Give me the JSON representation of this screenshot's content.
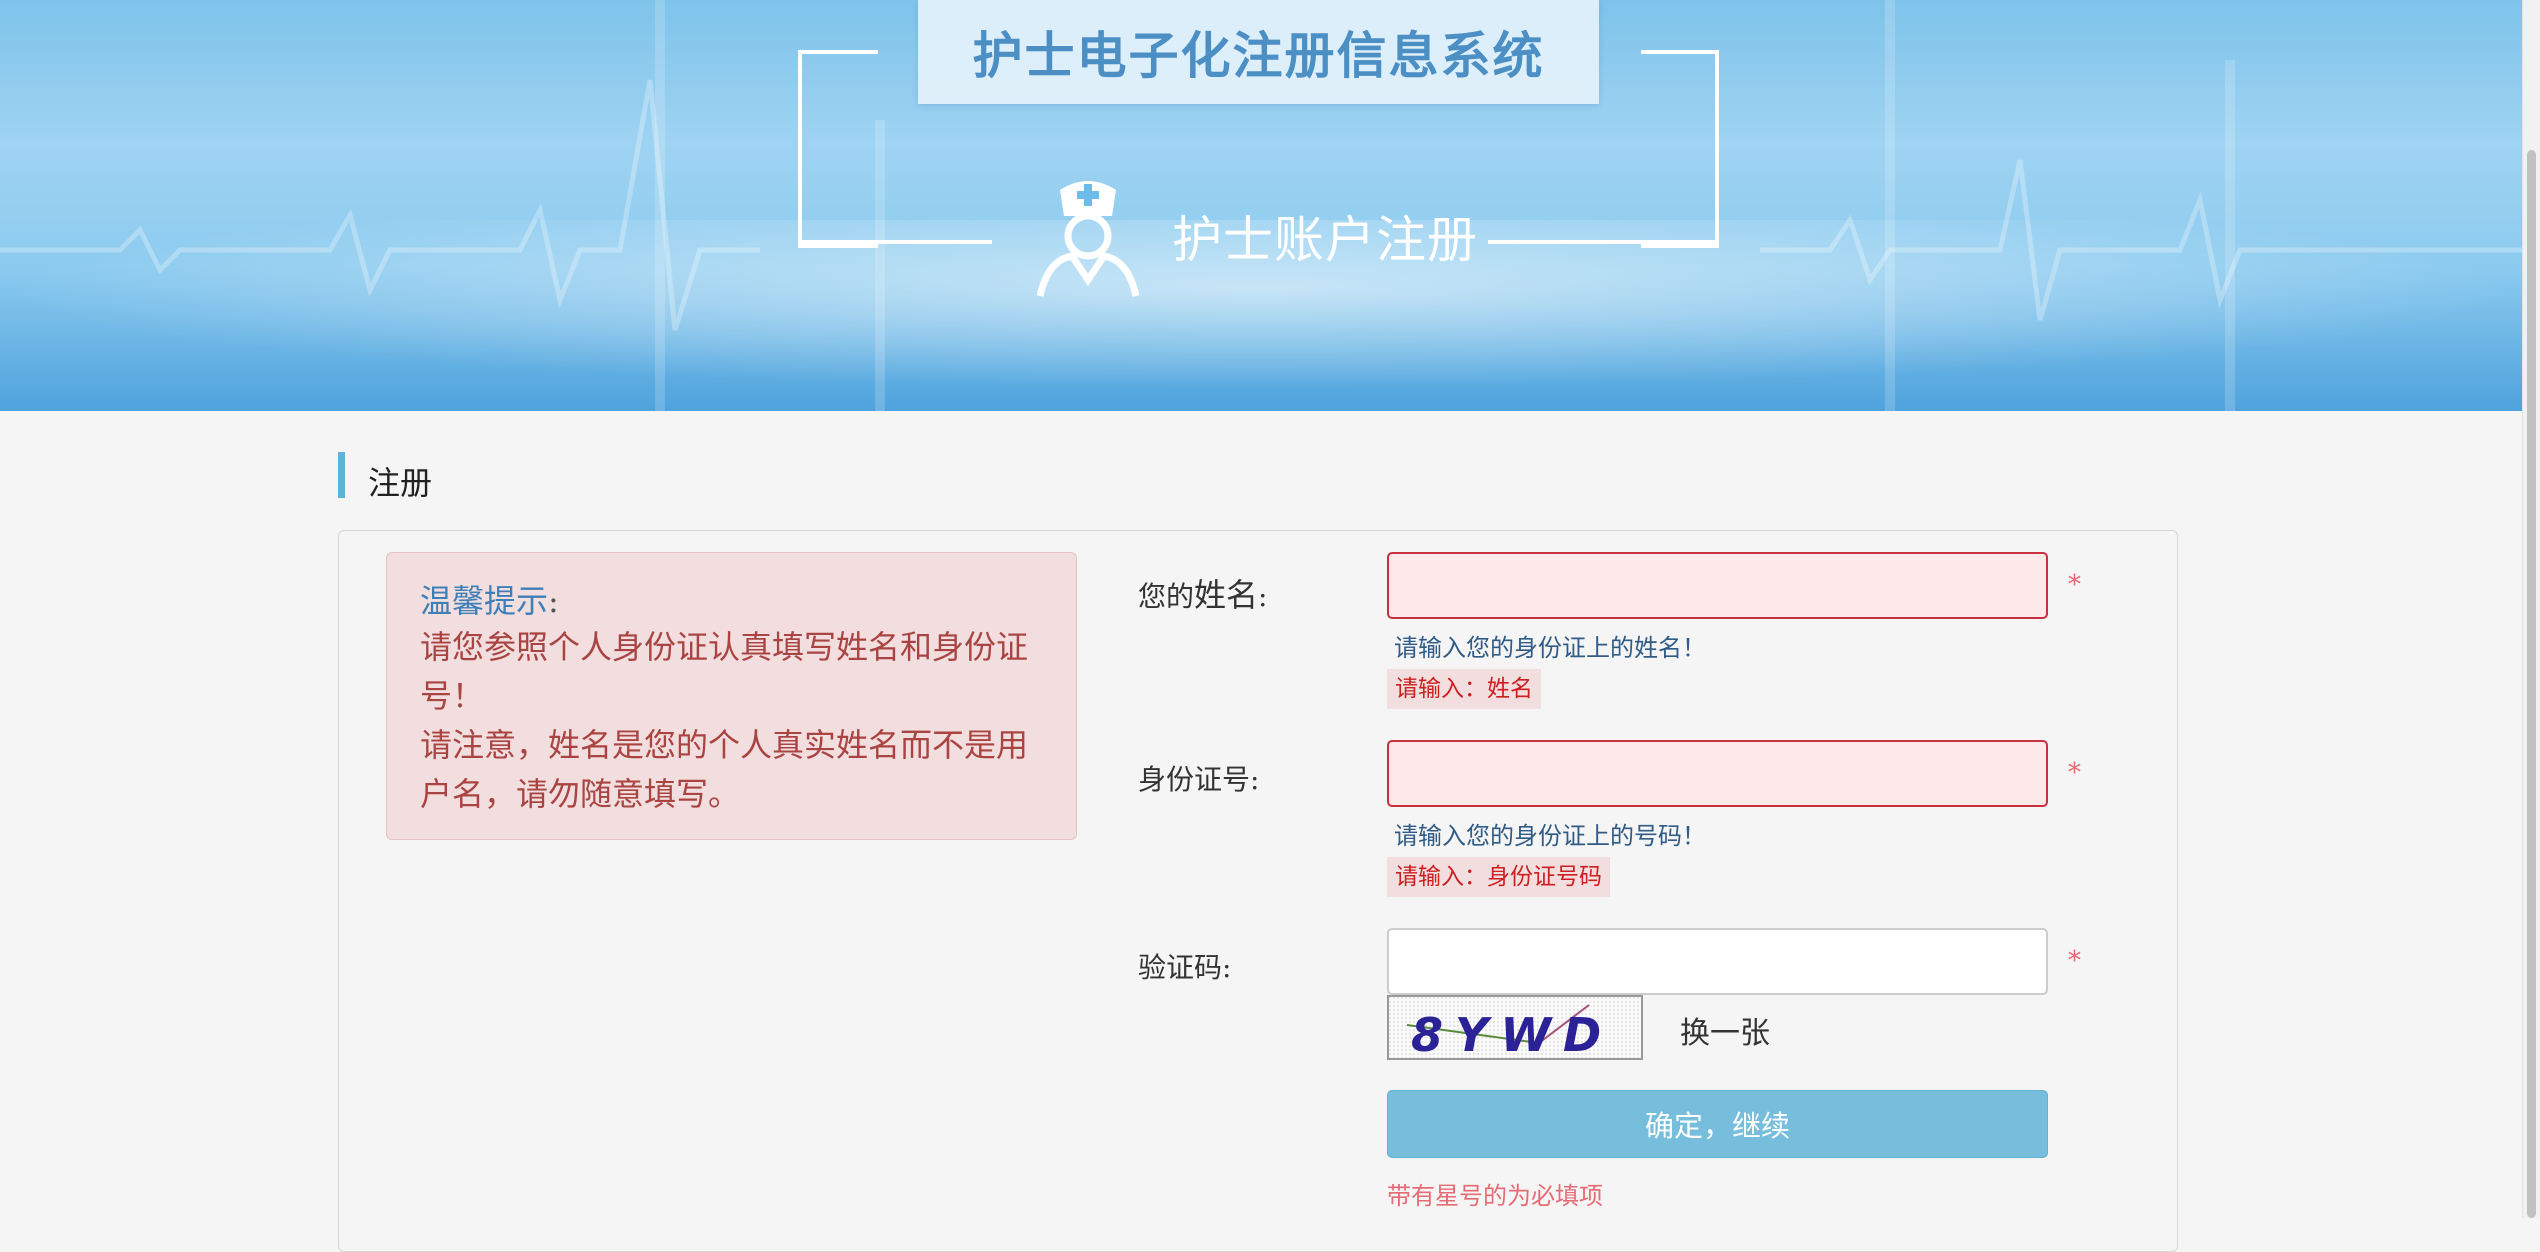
{
  "banner": {
    "title": "护士电子化注册信息系统",
    "subtitle": "护士账户注册"
  },
  "section": {
    "title": "注册"
  },
  "notice": {
    "title": "温馨提示",
    "colon": ":",
    "line1": "请您参照个人身份证认真填写姓名和身份证号！",
    "line2": "请注意，姓名是您的个人真实姓名而不是用户名，请勿随意填写。"
  },
  "form": {
    "name": {
      "label_prefix": "您的",
      "label_main": "姓名",
      "label_suffix": ":",
      "value": "",
      "required_mark": "*",
      "hint": "请输入您的身份证上的姓名！",
      "error": "请输入：姓名"
    },
    "id_number": {
      "label": "身份证号:",
      "value": "",
      "required_mark": "*",
      "hint": "请输入您的身份证上的号码！",
      "error": "请输入：身份证号码"
    },
    "captcha": {
      "label": "验证码:",
      "value": "",
      "required_mark": "*",
      "image_text": "8YWD",
      "refresh_label": "换一张"
    },
    "submit_label": "确定，继续",
    "required_note": "带有星号的为必填项"
  }
}
